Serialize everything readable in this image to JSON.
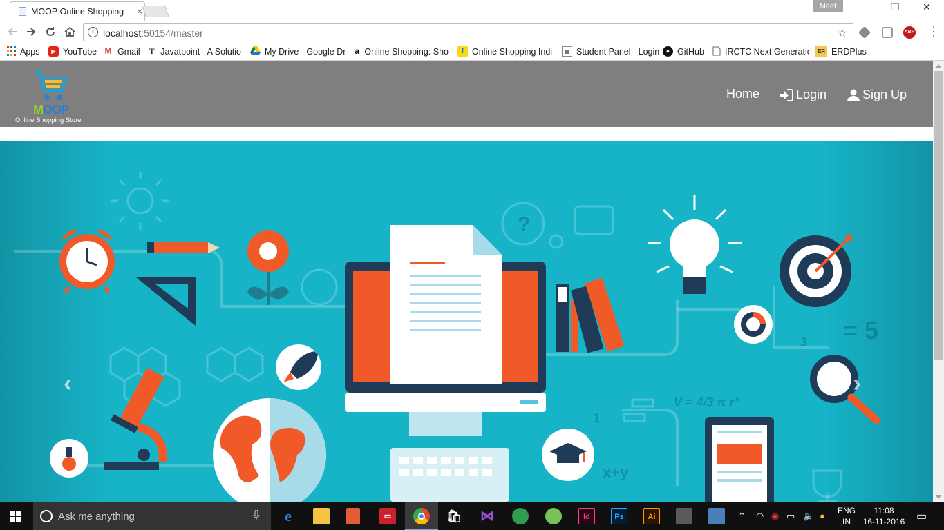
{
  "browser": {
    "tab_title": "MOOP:Online Shopping",
    "tab_close": "×",
    "profile_name": "Meet",
    "window_controls": {
      "minimize": "—",
      "maximize": "❐",
      "close": "✕"
    },
    "url_host": "localhost",
    "url_path": ":50154/master",
    "bookmarks": [
      {
        "label": "Apps",
        "icon": "apps-grid-icon"
      },
      {
        "label": "YouTube",
        "icon": "youtube-icon",
        "color": "#e62117"
      },
      {
        "label": "Gmail",
        "icon": "gmail-icon",
        "color": "#d44638"
      },
      {
        "label": "Javatpoint - A Solutio",
        "icon": "javatpoint-icon"
      },
      {
        "label": "My Drive - Google Dri",
        "icon": "google-drive-icon"
      },
      {
        "label": "Online Shopping: Sho",
        "icon": "amazon-icon"
      },
      {
        "label": "Online Shopping Indi",
        "icon": "flipkart-icon"
      },
      {
        "label": "Student Panel - Login",
        "icon": "student-panel-icon"
      },
      {
        "label": "GitHub",
        "icon": "github-icon"
      },
      {
        "label": "IRCTC Next Generatio",
        "icon": "page-icon"
      },
      {
        "label": "ERDPlus",
        "icon": "erdplus-icon"
      }
    ]
  },
  "site": {
    "logo_main": "M",
    "logo_accent": "OOP",
    "logo_subtitle": "Online Shopping Store",
    "nav": {
      "home": "Home",
      "login": "Login",
      "signup": "Sign Up"
    },
    "carousel": {
      "prev": "‹",
      "next": "›",
      "formula": "V = 4/3 π r³",
      "eq": "= 5",
      "num_3": "3",
      "num_1": "1",
      "xy": "x+y"
    },
    "colors": {
      "nav_bg": "#7f7f7f",
      "carousel_bg": "#17b4c8",
      "accent_orange": "#f05a28",
      "dark_navy": "#1f3b57"
    }
  },
  "taskbar": {
    "search_placeholder": "Ask me anything",
    "language": "ENG",
    "region": "IN",
    "time": "11:08",
    "date": "16-11-2016"
  }
}
